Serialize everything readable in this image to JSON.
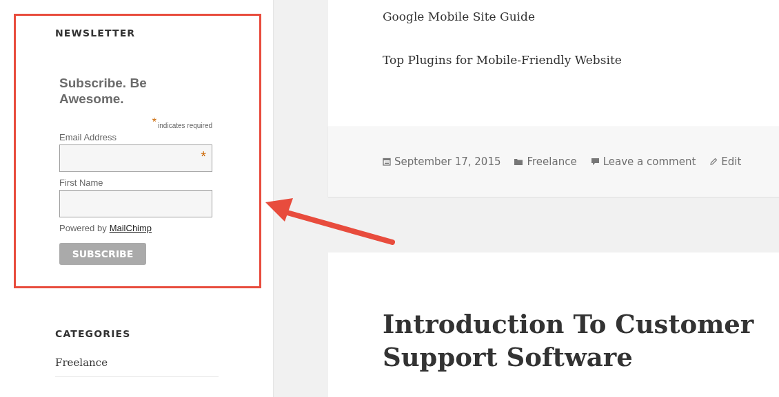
{
  "sidebar": {
    "newsletter": {
      "title": "NEWSLETTER",
      "form_heading": "Subscribe. Be Awesome.",
      "required_mark": "*",
      "required_note": "indicates required",
      "fields": [
        {
          "label": "Email Address",
          "required": true
        },
        {
          "label": "First Name",
          "required": false
        }
      ],
      "powered_by": "Powered by",
      "powered_link": "MailChimp",
      "button": "SUBSCRIBE"
    },
    "categories": {
      "title": "CATEGORIES",
      "items": [
        "Freelance"
      ]
    }
  },
  "posts": [
    {
      "links": [
        "Google Mobile Site Guide",
        "Top Plugins for Mobile-Friendly Website"
      ],
      "meta": [
        {
          "kind": "date",
          "text": "September 17, 2015"
        },
        {
          "kind": "category",
          "text": "Freelance"
        },
        {
          "kind": "comment",
          "text": "Leave a comment"
        },
        {
          "kind": "edit",
          "text": "Edit"
        }
      ]
    },
    {
      "title": "Introduction To Customer Support Software"
    }
  ]
}
